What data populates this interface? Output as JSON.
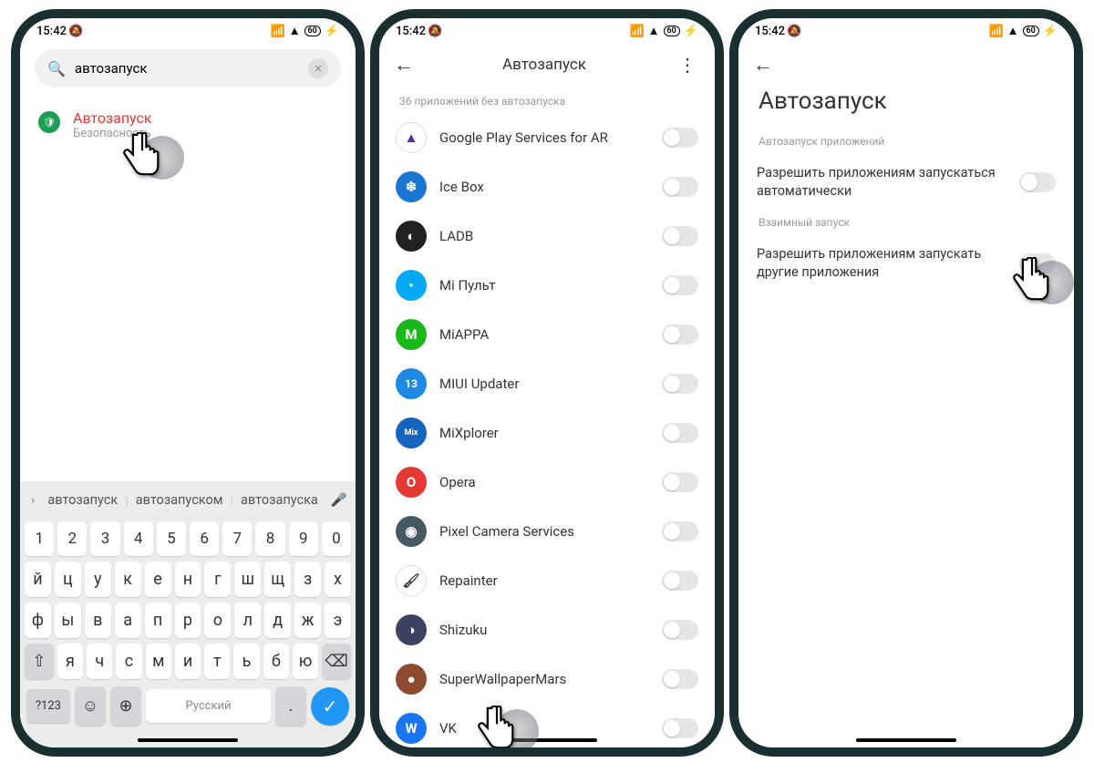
{
  "status": {
    "time": "15:42",
    "battery": "60"
  },
  "phone1": {
    "search_value": "автозапуск",
    "result": {
      "title": "Автозапуск",
      "subtitle": "Безопасность"
    },
    "suggestions": [
      "автозапуск",
      "автозапуском",
      "автозапуска"
    ],
    "keyboard": {
      "row_num": [
        "1",
        "2",
        "3",
        "4",
        "5",
        "6",
        "7",
        "8",
        "9",
        "0"
      ],
      "row1": [
        "й",
        "ц",
        "у",
        "к",
        "е",
        "н",
        "г",
        "ш",
        "щ",
        "з",
        "х"
      ],
      "row2": [
        "ф",
        "ы",
        "в",
        "а",
        "п",
        "р",
        "о",
        "л",
        "д",
        "ж",
        "э"
      ],
      "row3": [
        "я",
        "ч",
        "с",
        "м",
        "и",
        "т",
        "ь",
        "б",
        "ю"
      ],
      "shift": "⇧",
      "bksp": "⌫",
      "numkey": "?123",
      "emoji": "☺",
      "globe": "⊕",
      "space": "Русский",
      "enter": "✓"
    }
  },
  "phone2": {
    "title": "Автозапуск",
    "section": "36 приложений без автозапуска",
    "apps": [
      {
        "name": "Google Play Services for AR",
        "bg": "#fff",
        "letter": "▲",
        "fg": "#5b2aa0",
        "border": "1px solid #ddd"
      },
      {
        "name": "Ice Box",
        "bg": "#1976d2",
        "letter": "❄"
      },
      {
        "name": "LADB",
        "bg": "#222",
        "letter": "◐"
      },
      {
        "name": "Mi Пульт",
        "bg": "#03a9f4",
        "letter": "•"
      },
      {
        "name": "MiAPPA",
        "bg": "#17b817",
        "letter": "M"
      },
      {
        "name": "MIUI Updater",
        "bg": "#1e88e5",
        "letter": "13",
        "fs": "12px"
      },
      {
        "name": "MiXplorer",
        "bg": "#1565c0",
        "letter": "Mix",
        "fs": "9px"
      },
      {
        "name": "Opera",
        "bg": "#e53935",
        "letter": "O"
      },
      {
        "name": "Pixel Camera Services",
        "bg": "#455a64",
        "letter": "◉"
      },
      {
        "name": "Repainter",
        "bg": "#fff",
        "letter": "🖌",
        "border": "1px solid #ddd",
        "fg": "#333"
      },
      {
        "name": "Shizuku",
        "bg": "#3f4163",
        "letter": "◑"
      },
      {
        "name": "SuperWallpaperMars",
        "bg": "#8d4a2e",
        "letter": "●"
      },
      {
        "name": "VK",
        "bg": "#1976f2",
        "letter": "W"
      }
    ]
  },
  "phone3": {
    "title": "Автозапуск",
    "section1": "Автозапуск приложений",
    "row1": "Разрешить приложениям запускаться автоматически",
    "section2": "Взаимный запуск",
    "row2": "Разрешить приложениям запускать другие приложения"
  }
}
